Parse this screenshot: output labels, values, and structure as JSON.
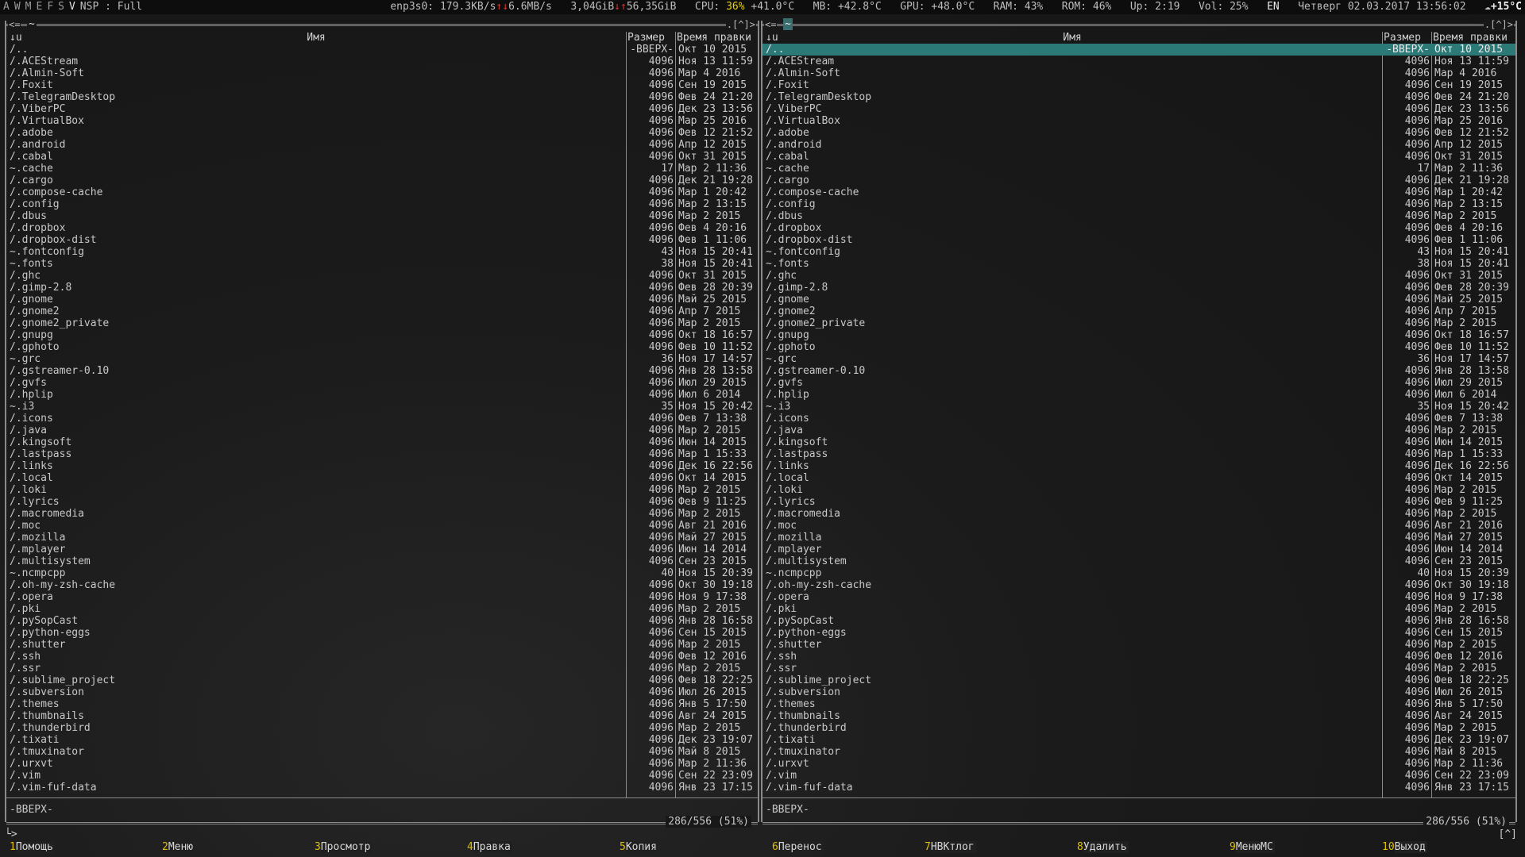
{
  "topbar": {
    "workspaces": [
      "A",
      "W",
      "M",
      "E",
      "F",
      "S",
      "V"
    ],
    "active_workspace": "V",
    "mode": "NSP : Full",
    "net_iface": "enp3s0:",
    "net_up": "179.3KB/s",
    "net_down": "6.6MB/s",
    "disk_used": "3,04GiB",
    "disk_free": "56,35GiB",
    "cpu_label": "CPU:",
    "cpu_value": "36%",
    "cpu_temp": "+41.0°C",
    "mb": "MB: +42.8°C",
    "gpu": "GPU: +48.0°C",
    "ram": "RAM: 43%",
    "rom": "ROM: 46%",
    "uptime": "Up: 2:19",
    "vol": "Vol: 25%",
    "lang": "EN",
    "datetime": "Четверг 02.03.2017 13:56:02",
    "weather": "+15°C"
  },
  "left_panel": {
    "path": "~",
    "sort": "↓u",
    "col_name": "Имя",
    "col_size": "Размер",
    "col_mtime": "Время правки",
    "mini_status": "-ВВЕРХ-",
    "free": "286/556 (51%)"
  },
  "right_panel": {
    "path": "~",
    "sort": "↓u",
    "col_name": "Имя",
    "col_size": "Размер",
    "col_mtime": "Время правки",
    "mini_status": "-ВВЕРХ-",
    "free": "286/556 (51%)",
    "selected_index": 0
  },
  "files": [
    {
      "name": "/..",
      "size": "-ВВЕРХ-",
      "mtime": "Окт 10  2015"
    },
    {
      "name": "/.ACEStream",
      "size": "4096",
      "mtime": "Ноя 13 11:59"
    },
    {
      "name": "/.Almin-Soft",
      "size": "4096",
      "mtime": "Мар  4  2016"
    },
    {
      "name": "/.Foxit",
      "size": "4096",
      "mtime": "Сен 19  2015"
    },
    {
      "name": "/.TelegramDesktop",
      "size": "4096",
      "mtime": "Фев 24 21:20"
    },
    {
      "name": "/.ViberPC",
      "size": "4096",
      "mtime": "Дек 23 13:56"
    },
    {
      "name": "/.VirtualBox",
      "size": "4096",
      "mtime": "Мар 25  2016"
    },
    {
      "name": "/.adobe",
      "size": "4096",
      "mtime": "Фев 12 21:52"
    },
    {
      "name": "/.android",
      "size": "4096",
      "mtime": "Апр 12  2015"
    },
    {
      "name": "/.cabal",
      "size": "4096",
      "mtime": "Окт 31  2015"
    },
    {
      "name": "~.cache",
      "size": "17",
      "mtime": "Мар  2 11:36"
    },
    {
      "name": "/.cargo",
      "size": "4096",
      "mtime": "Дек 21 19:28"
    },
    {
      "name": "/.compose-cache",
      "size": "4096",
      "mtime": "Мар  1 20:42"
    },
    {
      "name": "/.config",
      "size": "4096",
      "mtime": "Мар  2 13:15"
    },
    {
      "name": "/.dbus",
      "size": "4096",
      "mtime": "Мар  2  2015"
    },
    {
      "name": "/.dropbox",
      "size": "4096",
      "mtime": "Фев  4 20:16"
    },
    {
      "name": "/.dropbox-dist",
      "size": "4096",
      "mtime": "Фев  1 11:06"
    },
    {
      "name": "~.fontconfig",
      "size": "43",
      "mtime": "Ноя 15 20:41"
    },
    {
      "name": "~.fonts",
      "size": "38",
      "mtime": "Ноя 15 20:41"
    },
    {
      "name": "/.ghc",
      "size": "4096",
      "mtime": "Окт 31  2015"
    },
    {
      "name": "/.gimp-2.8",
      "size": "4096",
      "mtime": "Фев 28 20:39"
    },
    {
      "name": "/.gnome",
      "size": "4096",
      "mtime": "Май 25  2015"
    },
    {
      "name": "/.gnome2",
      "size": "4096",
      "mtime": "Апр  7  2015"
    },
    {
      "name": "/.gnome2_private",
      "size": "4096",
      "mtime": "Мар  2  2015"
    },
    {
      "name": "/.gnupg",
      "size": "4096",
      "mtime": "Окт 18 16:57"
    },
    {
      "name": "/.gphoto",
      "size": "4096",
      "mtime": "Фев 10 11:52"
    },
    {
      "name": "~.grc",
      "size": "36",
      "mtime": "Ноя 17 14:57"
    },
    {
      "name": "/.gstreamer-0.10",
      "size": "4096",
      "mtime": "Янв 28 13:58"
    },
    {
      "name": "/.gvfs",
      "size": "4096",
      "mtime": "Июл 29  2015"
    },
    {
      "name": "/.hplip",
      "size": "4096",
      "mtime": "Июл  6  2014"
    },
    {
      "name": "~.i3",
      "size": "35",
      "mtime": "Ноя 15 20:42"
    },
    {
      "name": "/.icons",
      "size": "4096",
      "mtime": "Фев  7 13:38"
    },
    {
      "name": "/.java",
      "size": "4096",
      "mtime": "Мар  2  2015"
    },
    {
      "name": "/.kingsoft",
      "size": "4096",
      "mtime": "Июн 14  2015"
    },
    {
      "name": "/.lastpass",
      "size": "4096",
      "mtime": "Мар  1 15:33"
    },
    {
      "name": "/.links",
      "size": "4096",
      "mtime": "Дек 16 22:56"
    },
    {
      "name": "/.local",
      "size": "4096",
      "mtime": "Окт 14  2015"
    },
    {
      "name": "/.loki",
      "size": "4096",
      "mtime": "Мар  2  2015"
    },
    {
      "name": "/.lyrics",
      "size": "4096",
      "mtime": "Фев  9 11:25"
    },
    {
      "name": "/.macromedia",
      "size": "4096",
      "mtime": "Мар  2  2015"
    },
    {
      "name": "/.moc",
      "size": "4096",
      "mtime": "Авг 21  2016"
    },
    {
      "name": "/.mozilla",
      "size": "4096",
      "mtime": "Май 27  2015"
    },
    {
      "name": "/.mplayer",
      "size": "4096",
      "mtime": "Июн 14  2014"
    },
    {
      "name": "/.multisystem",
      "size": "4096",
      "mtime": "Сен 23  2015"
    },
    {
      "name": "~.ncmpcpp",
      "size": "40",
      "mtime": "Ноя 15 20:39"
    },
    {
      "name": "/.oh-my-zsh-cache",
      "size": "4096",
      "mtime": "Окт 30 19:18"
    },
    {
      "name": "/.opera",
      "size": "4096",
      "mtime": "Ноя  9 17:38"
    },
    {
      "name": "/.pki",
      "size": "4096",
      "mtime": "Мар  2  2015"
    },
    {
      "name": "/.pySopCast",
      "size": "4096",
      "mtime": "Янв 28 16:58"
    },
    {
      "name": "/.python-eggs",
      "size": "4096",
      "mtime": "Сен 15  2015"
    },
    {
      "name": "/.shutter",
      "size": "4096",
      "mtime": "Мар  2  2015"
    },
    {
      "name": "/.ssh",
      "size": "4096",
      "mtime": "Фев 12  2016"
    },
    {
      "name": "/.ssr",
      "size": "4096",
      "mtime": "Мар  2  2015"
    },
    {
      "name": "/.sublime_project",
      "size": "4096",
      "mtime": "Фев 18 22:25"
    },
    {
      "name": "/.subversion",
      "size": "4096",
      "mtime": "Июл 26  2015"
    },
    {
      "name": "/.themes",
      "size": "4096",
      "mtime": "Янв  5 17:50"
    },
    {
      "name": "/.thumbnails",
      "size": "4096",
      "mtime": "Авг 24  2015"
    },
    {
      "name": "/.thunderbird",
      "size": "4096",
      "mtime": "Мар  2  2015"
    },
    {
      "name": "/.tixati",
      "size": "4096",
      "mtime": "Дек 23 19:07"
    },
    {
      "name": "/.tmuxinator",
      "size": "4096",
      "mtime": "Май  8  2015"
    },
    {
      "name": "/.urxvt",
      "size": "4096",
      "mtime": "Мар  2 11:36"
    },
    {
      "name": "/.vim",
      "size": "4096",
      "mtime": "Сен 22 23:09"
    },
    {
      "name": "/.vim-fuf-data",
      "size": "4096",
      "mtime": "Янв 23 17:15"
    }
  ],
  "cmdline": {
    "prompt": "└>",
    "right": "[^]"
  },
  "fkeys": [
    {
      "num": "1",
      "label": "Помощь"
    },
    {
      "num": "2",
      "label": "Меню"
    },
    {
      "num": "3",
      "label": "Просмотр"
    },
    {
      "num": "4",
      "label": "Правка"
    },
    {
      "num": "5",
      "label": "Копия"
    },
    {
      "num": "6",
      "label": "Перенос"
    },
    {
      "num": "7",
      "label": "НВКтлог"
    },
    {
      "num": "8",
      "label": "Удалить"
    },
    {
      "num": "9",
      "label": "МенюМС"
    },
    {
      "num": "10",
      "label": "Выход"
    }
  ],
  "colors": {
    "selection": "#2b7a78",
    "fkey_number": "#e0c000",
    "cpu_highlight": "#e8d200"
  }
}
